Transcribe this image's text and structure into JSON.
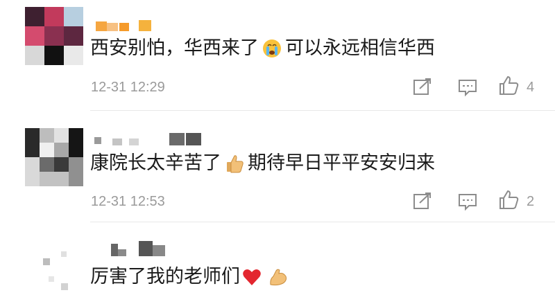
{
  "comments": [
    {
      "text_before": "西安别怕，华西来了",
      "emoji": "crying-face",
      "text_after": "可以永远相信华西",
      "time": "12-31 12:29",
      "likes": "4"
    },
    {
      "text_before": "康院长太辛苦了",
      "emoji": "thumbs-up",
      "text_after": "期待早日平平安安归来",
      "time": "12-31 12:53",
      "likes": "2"
    },
    {
      "text_before": "厉害了我的老师们",
      "emoji": "red-heart",
      "emoji2": "flexed-biceps",
      "text_after": ""
    }
  ],
  "colors": {
    "text": "#1a1a1a",
    "meta": "#9a9a9a",
    "icon": "#8c8c8c"
  }
}
